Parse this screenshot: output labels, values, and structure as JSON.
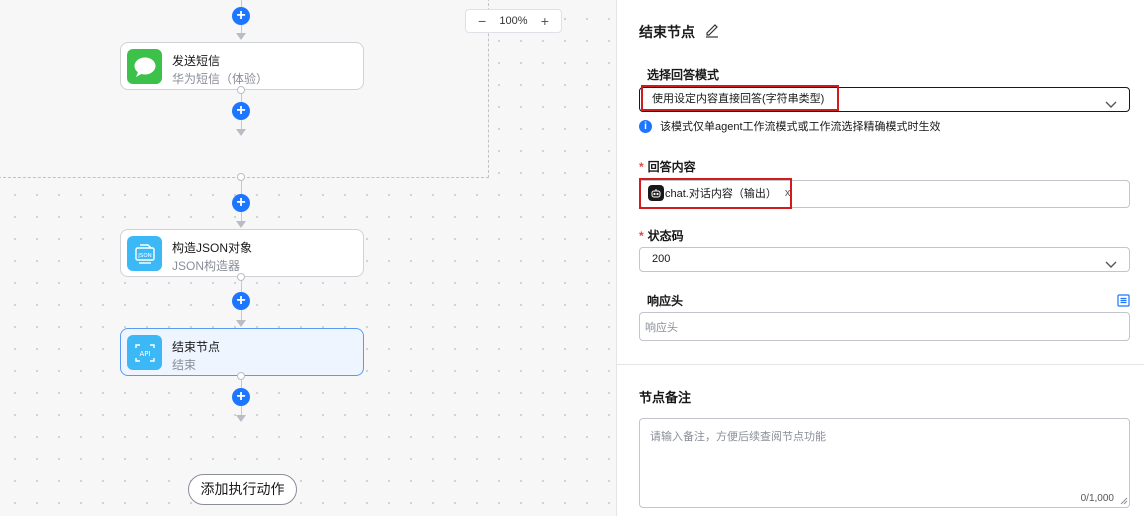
{
  "canvas": {
    "zoom": {
      "minus": "−",
      "value": "100%",
      "plus": "+"
    },
    "nodes": [
      {
        "title": "发送短信",
        "subtitle": "华为短信（体验）",
        "icon": "message-bubble-icon",
        "color": "#3cc24b"
      },
      {
        "title": "构造JSON对象",
        "subtitle": "JSON构造器",
        "icon": "json-icon",
        "color": "#3bb8f5"
      },
      {
        "title": "结束节点",
        "subtitle": "结束",
        "icon": "api-icon",
        "color": "#3bb8f5"
      }
    ],
    "add_action": "添加执行动作"
  },
  "panel": {
    "title": "结束节点",
    "mode_label": "选择回答模式",
    "mode_value": "使用设定内容直接回答(字符串类型)",
    "mode_info": "该模式仅单agent工作流模式或工作流选择精确模式时生效",
    "answer_label": "回答内容",
    "answer_chip": "chat.对话内容（输出）",
    "answer_chip_remove": "x",
    "status_label": "状态码",
    "status_value": "200",
    "header_label": "响应头",
    "header_placeholder": "响应头",
    "notes_title": "节点备注",
    "notes_placeholder": "请输入备注，方便后续查阅节点功能",
    "notes_counter": "0/1,000"
  },
  "colors": {
    "accent": "#1c76ff",
    "highlight": "#d21c1c",
    "selected_node_bg": "#eef5ff"
  }
}
